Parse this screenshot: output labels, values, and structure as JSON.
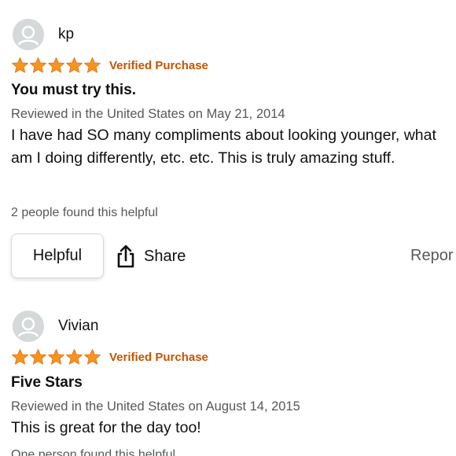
{
  "reviews": [
    {
      "profile_name": "kp",
      "rating": 5,
      "rating_max": 5,
      "verified_label": "Verified Purchase",
      "title": "You must try this.",
      "date_text": "Reviewed in the United States on May 21, 2014",
      "body": "I have had SO many compliments about looking younger, what am I doing differently, etc. etc. This is truly amazing stuff.",
      "helpful_count_text": "2 people found this helpful",
      "helpful_label": "Helpful",
      "share_label": "Share",
      "report_label": "Repor"
    },
    {
      "profile_name": "Vivian",
      "rating": 5,
      "rating_max": 5,
      "verified_label": "Verified Purchase",
      "title": "Five Stars",
      "date_text": "Reviewed in the United States on August 14, 2015",
      "body": "This is great for the day too!",
      "helpful_count_text": "One person found this helpful"
    }
  ],
  "colors": {
    "star": "#f7941d",
    "star_stroke": "#de7921",
    "verified": "#c45500",
    "avatar_bg": "#d5d9d9",
    "secondary_text": "#565959"
  },
  "icons": {
    "avatar": "user-avatar-icon",
    "star": "star-icon",
    "share": "share-icon"
  }
}
